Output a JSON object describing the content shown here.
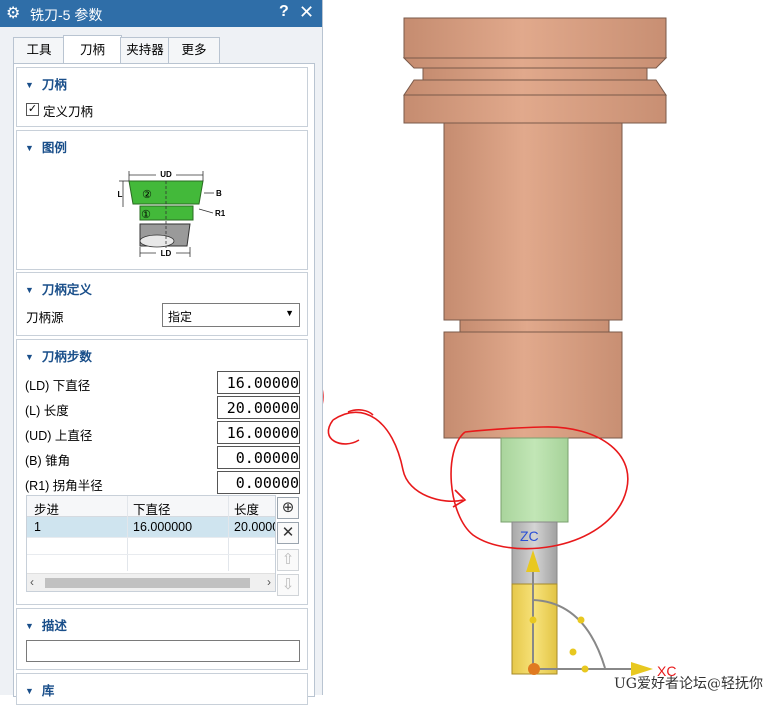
{
  "dialog": {
    "title": "铣刀-5 参数",
    "help": "?",
    "close": "✕",
    "tabs": [
      "工具",
      "刀柄",
      "夹持器",
      "更多"
    ],
    "active_tab": "刀柄"
  },
  "holder": {
    "header": "刀柄",
    "define_checkbox": "定义刀柄",
    "define_checked": true
  },
  "legend": {
    "header": "图例",
    "labels": {
      "ud": "UD",
      "l": "L",
      "b": "B",
      "r1": "R1",
      "ld": "LD",
      "n2": "②",
      "n1": "①"
    }
  },
  "holder_def": {
    "header": "刀柄定义",
    "source_label": "刀柄源",
    "source_value": "指定"
  },
  "steps": {
    "header": "刀柄步数",
    "fields": [
      {
        "label": "(LD) 下直径",
        "value": "16.00000"
      },
      {
        "label": "(L) 长度",
        "value": "20.00000"
      },
      {
        "label": "(UD) 上直径",
        "value": "16.00000"
      },
      {
        "label": "(B) 锥角",
        "value": "0.00000"
      },
      {
        "label": "(R1) 拐角半径",
        "value": "0.00000"
      }
    ],
    "table": {
      "columns": [
        "步进",
        "下直径",
        "长度"
      ],
      "rows": [
        [
          "1",
          "16.000000",
          "20.0000"
        ]
      ]
    }
  },
  "description": {
    "header": "描述",
    "value": ""
  },
  "library": {
    "header": "库"
  },
  "viewport": {
    "axis_zc": "ZC",
    "axis_xc": "XC",
    "watermark": "UG爱好者论坛@轻抚你"
  },
  "colors": {
    "title_bar": "#2f6ea8",
    "section_header": "#1a4f8a",
    "tool_copper": "#d9a184",
    "shank_green": "#b6deaa",
    "cutter_yellow": "#f2d95a",
    "annotation_red": "#e8191b",
    "axis_blue": "#2a4fd6"
  }
}
